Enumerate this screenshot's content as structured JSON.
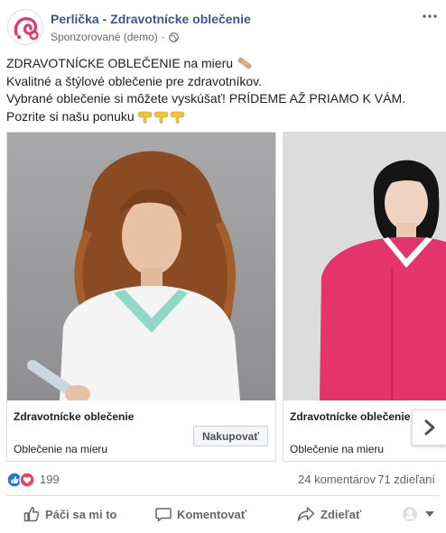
{
  "post": {
    "page_name": "Perlička - Zdravotnícke oblečenie",
    "sponsored_label": "Sponzorované (demo)",
    "separator": "·",
    "text_lines": [
      "ZDRAVOTNÍCKE OBLEČENIE na mieru",
      "Kvalitné a štýlové oblečenie pre zdravotníkov.",
      "Vybrané oblečenie si môžete vyskúšať! PRÍDEME AŽ PRIAMO K VÁM.",
      "Pozrite si našu ponuku"
    ]
  },
  "carousel": {
    "cards": [
      {
        "title": "Zdravotnícke oblečenie",
        "description": "Oblečenie na mieru",
        "button_label": "Nakupovať"
      },
      {
        "title": "Zdravotnícke oblečenie",
        "description": "Oblečenie na mieru"
      }
    ]
  },
  "stats": {
    "reactions_count": "199",
    "comments": "24 komentárov",
    "shares": "71 zdieľaní"
  },
  "actions": {
    "like": "Páči sa mi to",
    "comment": "Komentovať",
    "share": "Zdieľať"
  },
  "colors": {
    "link_blue": "#385898",
    "brand_pink": "#e8336f",
    "like_blue": "#1877f2",
    "love_red": "#f33e58"
  },
  "icons": [
    "brand-logo-icon",
    "more-options-icon",
    "globe-icon",
    "bandage-emoji-icon",
    "pointing-down-emoji-icon",
    "chevron-right-icon",
    "like-reaction-icon",
    "love-reaction-icon",
    "thumbs-up-icon",
    "comment-icon",
    "share-icon",
    "audience-icon",
    "caret-down-icon"
  ]
}
